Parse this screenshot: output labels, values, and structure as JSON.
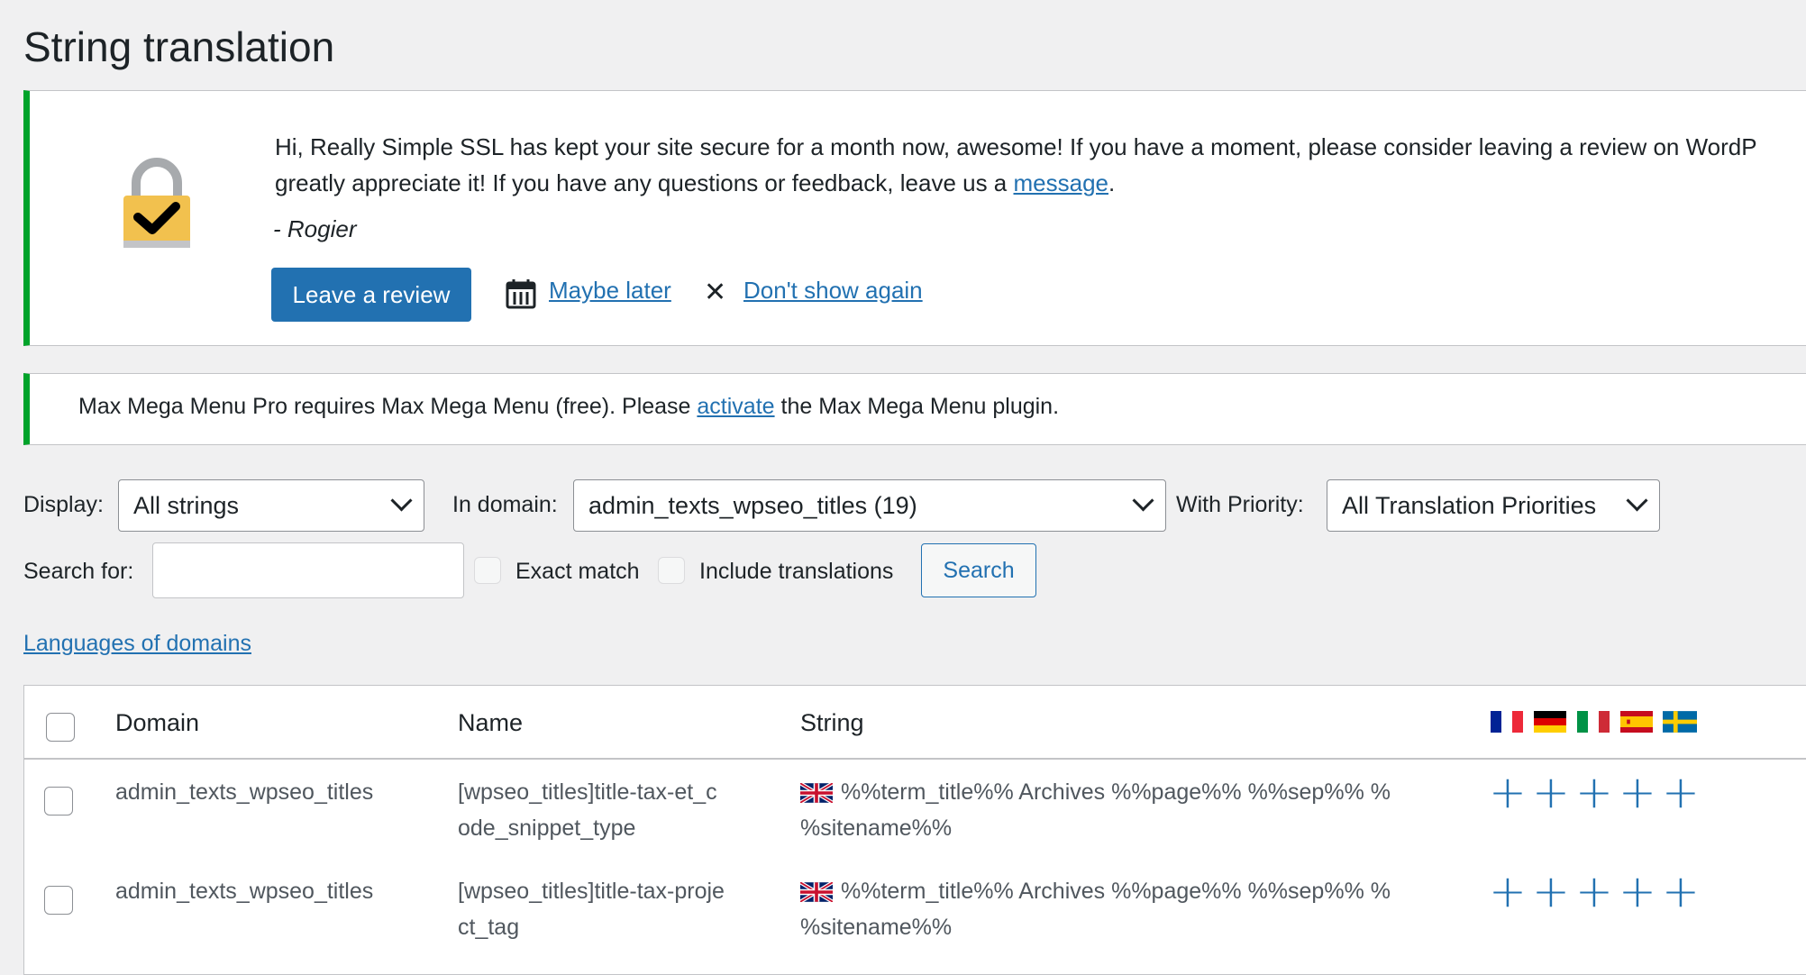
{
  "page": {
    "title": "String translation"
  },
  "ssl_notice": {
    "line1": "Hi, Really Simple SSL has kept your site secure for a month now, awesome! If you have a moment, please consider leaving a review on WordP",
    "line2_prefix": "greatly appreciate it! If you have any questions or feedback, leave us a ",
    "line2_link": "message",
    "line2_suffix": ".",
    "signature": "- Rogier",
    "review_button": "Leave a review",
    "maybe_later": "Maybe later",
    "dismiss_symbol": "✕",
    "dont_show": "Don't show again",
    "lock_color": "#f2c14e",
    "accent": "#00a32a"
  },
  "mmm_notice": {
    "prefix": "Max Mega Menu Pro requires Max Mega Menu (free). Please ",
    "link": "activate",
    "suffix": " the Max Mega Menu plugin."
  },
  "filters": {
    "display_label": "Display:",
    "display_value": "All strings",
    "domain_label": "In domain:",
    "domain_value": "admin_texts_wpseo_titles (19)",
    "priority_label": "With Priority:",
    "priority_value": "All Translation Priorities",
    "search_label": "Search for:",
    "search_value": "",
    "exact_match": "Exact match",
    "include_translations": "Include translations",
    "search_button": "Search",
    "languages_link": "Languages of domains"
  },
  "table": {
    "headers": {
      "domain": "Domain",
      "name": "Name",
      "string": "String"
    },
    "language_flags": [
      "flag-fr-icon",
      "flag-de-icon",
      "flag-it-icon",
      "flag-es-icon",
      "flag-se-icon"
    ],
    "rows": [
      {
        "domain": "admin_texts_wpseo_titles",
        "name_line1": "[wpseo_titles]title-tax-et_c",
        "name_line2": "ode_snippet_type",
        "string_line1": "%%term_title%% Archives %%page%% %%sep%% %",
        "string_line2": "%sitename%%",
        "source_flag": "flag-gb-icon",
        "add_symbol": "+"
      },
      {
        "domain": "admin_texts_wpseo_titles",
        "name_line1": "[wpseo_titles]title-tax-proje",
        "name_line2": "ct_tag",
        "string_line1": "%%term_title%% Archives %%page%% %%sep%% %",
        "string_line2": "%sitename%%",
        "source_flag": "flag-gb-icon",
        "add_symbol": "+"
      }
    ],
    "link_color": "#2271b1"
  }
}
